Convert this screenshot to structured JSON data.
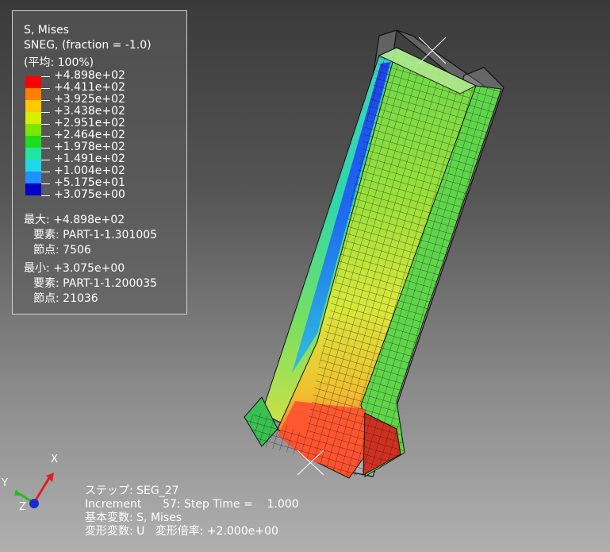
{
  "legend": {
    "title": "S, Mises",
    "subtitle": "SNEG, (fraction = -1.0)",
    "average": "(平均: 100%)",
    "levels": [
      {
        "label": "+4.898e+02",
        "color": "#ff0000"
      },
      {
        "label": "+4.411e+02",
        "color": "#ff7f00"
      },
      {
        "label": "+3.925e+02",
        "color": "#ffc800"
      },
      {
        "label": "+3.438e+02",
        "color": "#d4f000"
      },
      {
        "label": "+2.951e+02",
        "color": "#7ce600"
      },
      {
        "label": "+2.464e+02",
        "color": "#20dc20"
      },
      {
        "label": "+1.978e+02",
        "color": "#1ee6a0"
      },
      {
        "label": "+1.491e+02",
        "color": "#1ed8e8"
      },
      {
        "label": "+1.004e+02",
        "color": "#1e90ff"
      },
      {
        "label": "+5.175e+01",
        "color": "#1e40f0"
      },
      {
        "label": "+3.075e+00",
        "color": "#0000c8"
      }
    ],
    "max_line": "最大: +4.898e+02",
    "max_element": "要素: PART-1-1.301005",
    "max_node": "節点: 7506",
    "min_line": "最小: +3.075e+00",
    "min_element": "要素: PART-1-1.200035",
    "min_node": "節点: 21036"
  },
  "status": {
    "step": "ステップ: SEG_27",
    "increment": "Increment      57: Step Time =    1.000",
    "primary_var": "基本変数: S, Mises",
    "deformed_var": "変形変数: U   変形倍率: +2.000e+00"
  },
  "triad": {
    "x_label": "X",
    "y_label": "Y",
    "z_label": "Z"
  }
}
